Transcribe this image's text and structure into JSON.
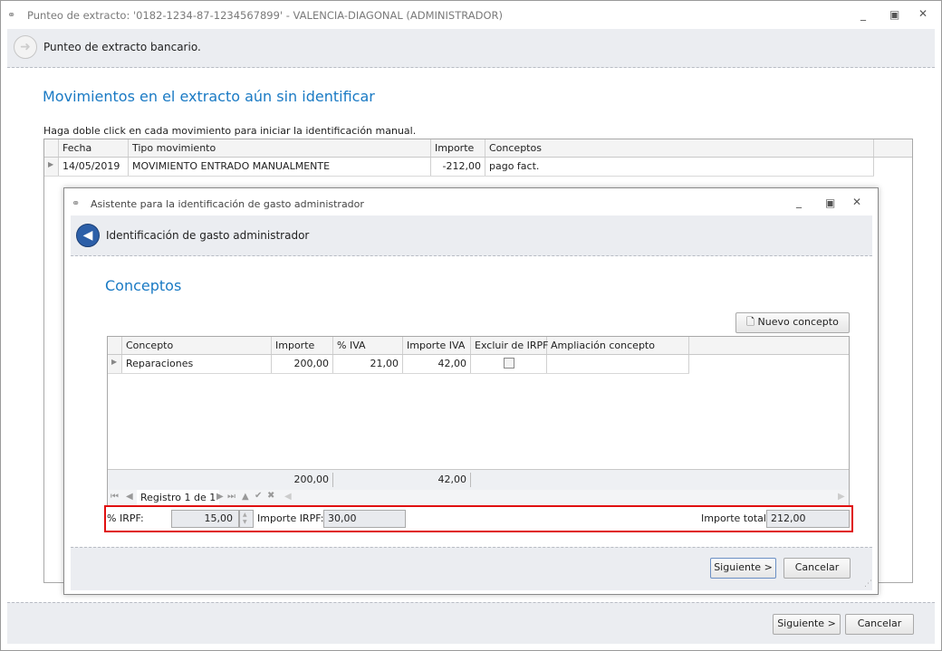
{
  "window": {
    "title": "Punteo de extracto: '0182-1234-87-1234567899' - VALENCIA-DIAGONAL (ADMINISTRADOR)",
    "header": "Punteo de extracto bancario.",
    "heading": "Movimientos en el extracto aún sin identificar",
    "hint": "Haga doble click en cada movimiento para iniciar la identificación manual.",
    "columns": [
      "Fecha",
      "Tipo movimiento",
      "Importe",
      "Conceptos"
    ],
    "rows": [
      {
        "fecha": "14/05/2019",
        "tipo": "MOVIMIENTO ENTRADO MANUALMENTE",
        "importe": "-212,00",
        "conceptos": "pago fact."
      }
    ],
    "next": "Siguiente >",
    "cancel": "Cancelar"
  },
  "dialog": {
    "title": "Asistente para la identificación de gasto administrador",
    "header": "Identificación de gasto administrador",
    "heading": "Conceptos",
    "new_button": "Nuevo concepto",
    "columns": [
      "Concepto",
      "Importe",
      "% IVA",
      "Importe IVA",
      "Excluir de IRPF",
      "Ampliación concepto"
    ],
    "rows": [
      {
        "concepto": "Reparaciones",
        "importe": "200,00",
        "iva": "21,00",
        "importe_iva": "42,00",
        "excluir": false,
        "ampliacion": ""
      }
    ],
    "totals": {
      "importe": "200,00",
      "importe_iva": "42,00"
    },
    "navigator": "Registro 1 de 1",
    "irpf_label": "% IRPF:",
    "irpf_value": "15,00",
    "importe_irpf_label": "Importe IRPF:",
    "importe_irpf_value": "30,00",
    "total_label": "Importe total:",
    "total_value": "212,00",
    "next": "Siguiente >",
    "cancel": "Cancelar"
  }
}
